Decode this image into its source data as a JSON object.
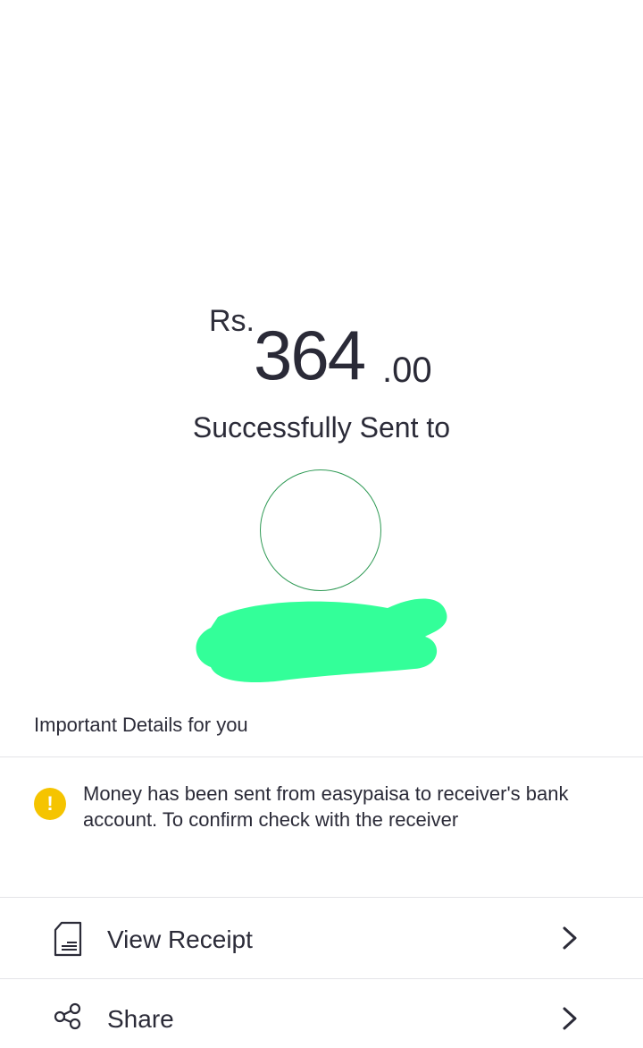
{
  "transaction": {
    "currency": "Rs.",
    "amount_whole": "364",
    "amount_decimal": ".00",
    "status_text": "Successfully Sent to"
  },
  "details": {
    "heading": "Important Details for you",
    "notice_icon": "!",
    "notice_text": "Money has been sent from easypaisa to receiver's bank account. To confirm check with the receiver"
  },
  "actions": {
    "view_receipt": {
      "label": "View Receipt",
      "icon": "receipt-icon"
    },
    "share": {
      "label": "Share",
      "icon": "share-icon"
    }
  },
  "colors": {
    "avatar_ring": "#2f9a55",
    "redaction": "#33ff99",
    "notice_icon": "#f5c400"
  }
}
